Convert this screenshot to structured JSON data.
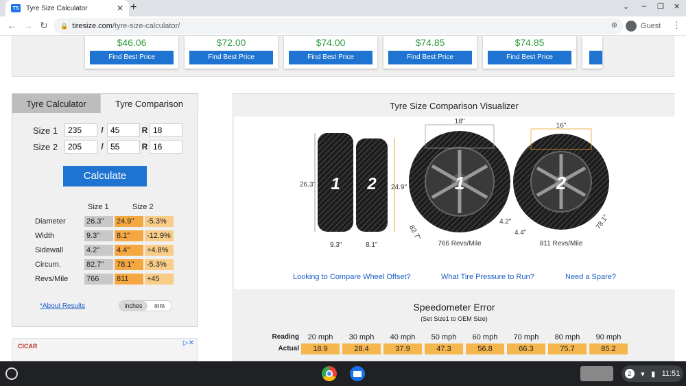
{
  "browser": {
    "tab_title": "Tyre Size Calculator",
    "favicon_text": "TS",
    "new_tab": "+",
    "url_host": "tiresize.com",
    "url_path": "/tyre-size-calculator/",
    "profile": "Guest"
  },
  "price_cards": [
    {
      "price": "$46.06",
      "button": "Find Best Price"
    },
    {
      "price": "$72.00",
      "button": "Find Best Price"
    },
    {
      "price": "$74.00",
      "button": "Find Best Price"
    },
    {
      "price": "$74.85",
      "button": "Find Best Price"
    },
    {
      "price": "$74.85",
      "button": "Find Best Price"
    }
  ],
  "calculator": {
    "tabs": [
      "Tyre Calculator",
      "Tyre Comparison"
    ],
    "size1_label": "Size 1",
    "size2_label": "Size 2",
    "size1": {
      "width": "235",
      "ratio": "45",
      "rim": "18"
    },
    "size2": {
      "width": "205",
      "ratio": "55",
      "rim": "16"
    },
    "sep_slash": "/",
    "sep_r": "R",
    "calculate": "Calculate",
    "col_size1": "Size 1",
    "col_size2": "Size 2",
    "rows": [
      {
        "label": "Diameter",
        "s1": "26.3\"",
        "s2": "24.9\"",
        "diff": "-5.3%"
      },
      {
        "label": "Width",
        "s1": "9.3\"",
        "s2": "8.1\"",
        "diff": "-12.9%"
      },
      {
        "label": "Sidewall",
        "s1": "4.2\"",
        "s2": "4.4\"",
        "diff": "+4.8%"
      },
      {
        "label": "Circum.",
        "s1": "82.7\"",
        "s2": "78.1\"",
        "diff": "-5.3%"
      },
      {
        "label": "Revs/Mile",
        "s1": "766",
        "s2": "811",
        "diff": "+45"
      }
    ],
    "about_link": "*About Results",
    "unit_inches": "inches",
    "unit_mm": "mm"
  },
  "ad": {
    "logo": "CICAR"
  },
  "visualizer": {
    "title": "Tyre Size Comparison Visualizer",
    "tire1_num": "1",
    "tire2_num": "2",
    "dia1": "26.3\"",
    "dia2": "24.9\"",
    "width1": "9.3\"",
    "width2": "8.1\"",
    "rim1": "18\"",
    "rim2": "16\"",
    "side1": "4.2\"",
    "side2": "4.4\"",
    "circ1": "82.7\"",
    "circ2": "78.1\"",
    "revs1": "766 Revs/Mile",
    "revs2": "811 Revs/Mile",
    "links": [
      "Looking to Compare Wheel Offset?",
      "What Tire Pressure to Run?",
      "Need a Spare?"
    ]
  },
  "speedometer": {
    "title": "Speedometer Error",
    "subtitle": "(Set Size1 to OEM Size)",
    "reading_label": "Reading",
    "actual_label": "Actual",
    "reading": [
      "20 mph",
      "30 mph",
      "40 mph",
      "50 mph",
      "60 mph",
      "70 mph",
      "80 mph",
      "90 mph"
    ],
    "actual": [
      "18.9",
      "28.4",
      "37.9",
      "47.3",
      "56.8",
      "66.3",
      "75.7",
      "85.2"
    ]
  },
  "taskbar": {
    "notifications": "2",
    "time": "11:51"
  },
  "colors": {
    "accent_blue": "#1e74d0",
    "price_green": "#2e9a3b",
    "orange": "#f5a742",
    "light_orange": "#f9cc88"
  }
}
